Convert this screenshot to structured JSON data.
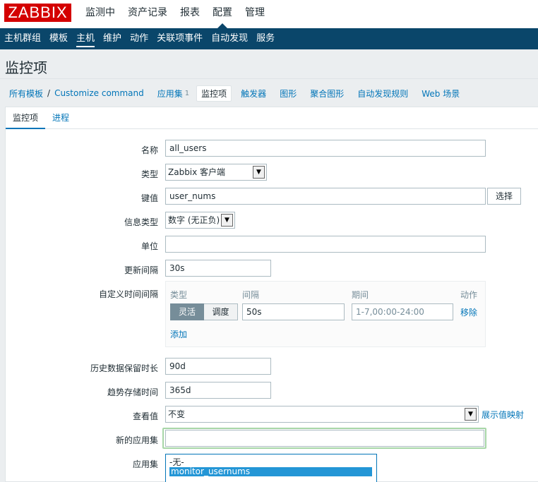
{
  "logo": "ZABBIX",
  "main_nav": [
    "监测中",
    "资产记录",
    "报表",
    "配置",
    "管理"
  ],
  "main_nav_active": "配置",
  "sub_nav": [
    "主机群组",
    "模板",
    "主机",
    "维护",
    "动作",
    "关联项事件",
    "自动发现",
    "服务"
  ],
  "sub_nav_active": "主机",
  "page_title": "监控项",
  "breadcrumb": {
    "all_templates": "所有模板",
    "separator": "/",
    "template": "Customize command",
    "apps": "应用集",
    "apps_count": "1",
    "items": "监控项",
    "triggers": "触发器",
    "graphs": "图形",
    "screens": "聚合图形",
    "discovery": "自动发现规则",
    "web": "Web 场景"
  },
  "form_tabs": [
    "监控项",
    "进程"
  ],
  "form": {
    "name_label": "名称",
    "name_value": "all_users",
    "type_label": "类型",
    "type_value": "Zabbix 客户端",
    "key_label": "键值",
    "key_value": "user_nums",
    "select_button": "选择",
    "info_type_label": "信息类型",
    "info_type_value": "数字 (无正负)",
    "units_label": "单位",
    "units_value": "",
    "update_label": "更新间隔",
    "update_value": "30s",
    "custom_label": "自定义时间间隔",
    "custom": {
      "col_type": "类型",
      "col_interval": "间隔",
      "col_period": "期间",
      "col_action": "动作",
      "flexible": "灵活",
      "scheduling": "调度",
      "interval_value": "50s",
      "period_placeholder": "1-7,00:00-24:00",
      "remove": "移除",
      "add": "添加"
    },
    "history_label": "历史数据保留时长",
    "history_value": "90d",
    "trends_label": "趋势存储时间",
    "trends_value": "365d",
    "valuemap_label": "查看值",
    "valuemap_value": "不变",
    "valuemap_link": "展示值映射",
    "new_app_label": "新的应用集",
    "new_app_value": "",
    "apps_label": "应用集",
    "apps_options": [
      "-无-",
      "monitor_usernums"
    ]
  }
}
